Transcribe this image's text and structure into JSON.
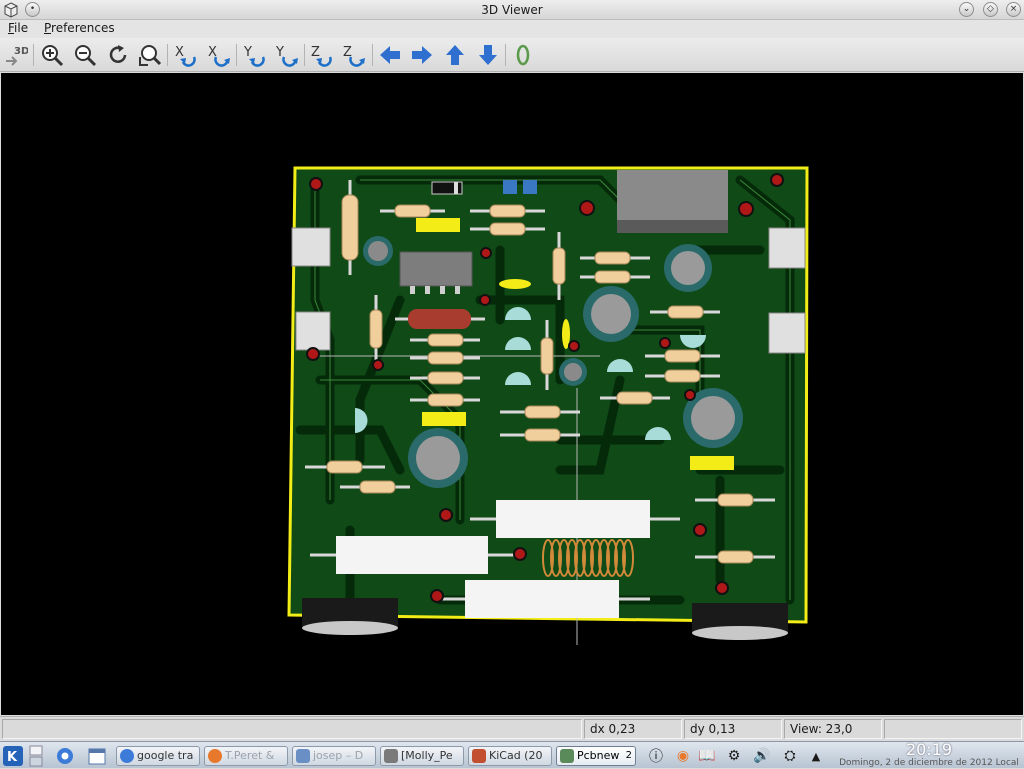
{
  "window": {
    "title": "3D Viewer",
    "app_icon": "cube-icon"
  },
  "menu": {
    "file": "File",
    "preferences": "Preferences"
  },
  "toolbar": {
    "items": [
      {
        "name": "reload-3d-button",
        "icon": "3d-reload-icon"
      },
      {
        "name": "zoom-in-button",
        "icon": "zoom-in-icon"
      },
      {
        "name": "zoom-out-button",
        "icon": "zoom-out-icon"
      },
      {
        "name": "redraw-button",
        "icon": "redraw-icon"
      },
      {
        "name": "zoom-fit-button",
        "icon": "zoom-fit-icon"
      },
      {
        "name": "rotate-x-cw-button",
        "icon": "rotate-x-icon",
        "letter": "X"
      },
      {
        "name": "rotate-x-ccw-button",
        "icon": "rotate-x-back-icon",
        "letter": "X"
      },
      {
        "name": "rotate-y-cw-button",
        "icon": "rotate-y-icon",
        "letter": "Y"
      },
      {
        "name": "rotate-y-ccw-button",
        "icon": "rotate-y-back-icon",
        "letter": "Y"
      },
      {
        "name": "rotate-z-cw-button",
        "icon": "rotate-z-icon",
        "letter": "Z"
      },
      {
        "name": "rotate-z-ccw-button",
        "icon": "rotate-z-back-icon",
        "letter": "Z"
      },
      {
        "name": "move-left-button",
        "icon": "arrow-left-icon"
      },
      {
        "name": "move-right-button",
        "icon": "arrow-right-icon"
      },
      {
        "name": "move-up-button",
        "icon": "arrow-up-icon"
      },
      {
        "name": "move-down-button",
        "icon": "arrow-down-icon"
      },
      {
        "name": "ortho-toggle-button",
        "icon": "ortho-icon"
      }
    ]
  },
  "status": {
    "message": "",
    "dx": "dx 0,23",
    "dy": "dy 0,13",
    "view": "View: 23,0"
  },
  "taskbar": {
    "tasks": [
      {
        "label": "google tra",
        "icon": "chrome-icon",
        "color": "#3d7bd9",
        "faded": false,
        "active": false
      },
      {
        "label": "T.Peret &",
        "icon": "firefox-icon",
        "color": "#e8792c",
        "faded": true,
        "active": false
      },
      {
        "label": "josep – D",
        "icon": "dolphin-icon",
        "color": "#6a8fc4",
        "faded": true,
        "active": false
      },
      {
        "label": "[Molly_Pe",
        "icon": "document-icon",
        "color": "#7a7a7a",
        "faded": false,
        "active": false
      },
      {
        "label": "KiCad (20",
        "icon": "kicad-icon",
        "color": "#c24f2f",
        "faded": false,
        "active": false
      },
      {
        "label": "Pcbnew",
        "icon": "pcbnew-icon",
        "color": "#5a8a5a",
        "faded": false,
        "active": true,
        "count": "2"
      }
    ],
    "clock_time": "20:19",
    "clock_date": "Domingo, 2 de diciembre de 2012 Local"
  }
}
